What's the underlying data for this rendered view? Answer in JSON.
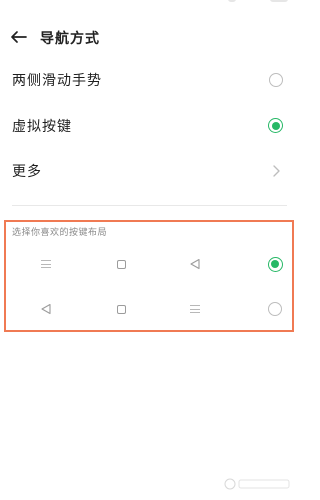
{
  "header": {
    "title": "导航方式",
    "back_icon": "arrow-left-icon"
  },
  "options": [
    {
      "label": "两侧滑动手势",
      "control": "radio",
      "selected": false
    },
    {
      "label": "虚拟按键",
      "control": "radio",
      "selected": true
    },
    {
      "label": "更多",
      "control": "chevron"
    }
  ],
  "section": {
    "title": "选择你喜欢的按键布局",
    "layouts": [
      {
        "icons": [
          "menu-icon",
          "home-square-icon",
          "back-triangle-icon"
        ],
        "selected": true
      },
      {
        "icons": [
          "back-triangle-icon",
          "home-square-icon",
          "menu-icon"
        ],
        "selected": false
      }
    ]
  },
  "colors": {
    "accent": "#27b866",
    "highlight_border": "#f07a53"
  }
}
